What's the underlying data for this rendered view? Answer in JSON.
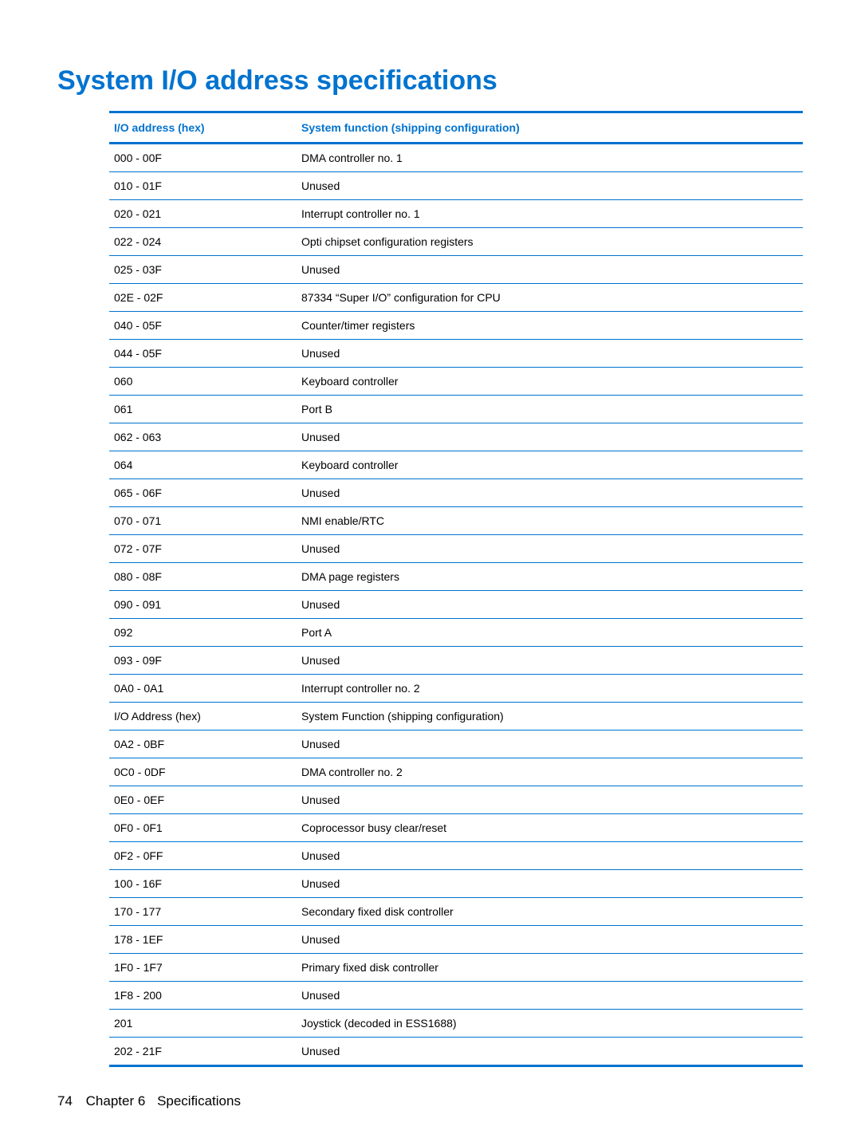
{
  "title": "System I/O address specifications",
  "table": {
    "headers": {
      "address": "I/O address (hex)",
      "function": "System function (shipping configuration)"
    },
    "rows": [
      {
        "address": "000 - 00F",
        "function": "DMA controller no. 1"
      },
      {
        "address": "010 - 01F",
        "function": "Unused"
      },
      {
        "address": "020 - 021",
        "function": "Interrupt controller no. 1"
      },
      {
        "address": "022 - 024",
        "function": "Opti chipset configuration registers"
      },
      {
        "address": "025 - 03F",
        "function": "Unused"
      },
      {
        "address": "02E - 02F",
        "function": "87334 “Super I/O” configuration for CPU"
      },
      {
        "address": "040 - 05F",
        "function": "Counter/timer registers"
      },
      {
        "address": "044 - 05F",
        "function": "Unused"
      },
      {
        "address": "060",
        "function": "Keyboard controller"
      },
      {
        "address": "061",
        "function": "Port B"
      },
      {
        "address": "062 - 063",
        "function": "Unused"
      },
      {
        "address": "064",
        "function": "Keyboard controller"
      },
      {
        "address": "065 - 06F",
        "function": "Unused"
      },
      {
        "address": "070 - 071",
        "function": "NMI enable/RTC"
      },
      {
        "address": "072 - 07F",
        "function": "Unused"
      },
      {
        "address": "080 - 08F",
        "function": "DMA page registers"
      },
      {
        "address": "090 - 091",
        "function": "Unused"
      },
      {
        "address": "092",
        "function": "Port A"
      },
      {
        "address": "093 - 09F",
        "function": "Unused"
      },
      {
        "address": "0A0 - 0A1",
        "function": "Interrupt controller no. 2"
      },
      {
        "address": "I/O Address (hex)",
        "function": "System Function (shipping configuration)"
      },
      {
        "address": "0A2 - 0BF",
        "function": "Unused"
      },
      {
        "address": "0C0 - 0DF",
        "function": "DMA controller no. 2"
      },
      {
        "address": "0E0 - 0EF",
        "function": "Unused"
      },
      {
        "address": "0F0 - 0F1",
        "function": "Coprocessor busy clear/reset"
      },
      {
        "address": "0F2 - 0FF",
        "function": "Unused"
      },
      {
        "address": "100 - 16F",
        "function": "Unused"
      },
      {
        "address": "170 - 177",
        "function": "Secondary fixed disk controller"
      },
      {
        "address": "178 - 1EF",
        "function": "Unused"
      },
      {
        "address": "1F0 - 1F7",
        "function": "Primary fixed disk controller"
      },
      {
        "address": "1F8 - 200",
        "function": "Unused"
      },
      {
        "address": "201",
        "function": "Joystick (decoded in ESS1688)"
      },
      {
        "address": "202 - 21F",
        "function": "Unused"
      }
    ]
  },
  "footer": {
    "page_number": "74",
    "chapter_label": "Chapter 6",
    "chapter_title": "Specifications"
  }
}
